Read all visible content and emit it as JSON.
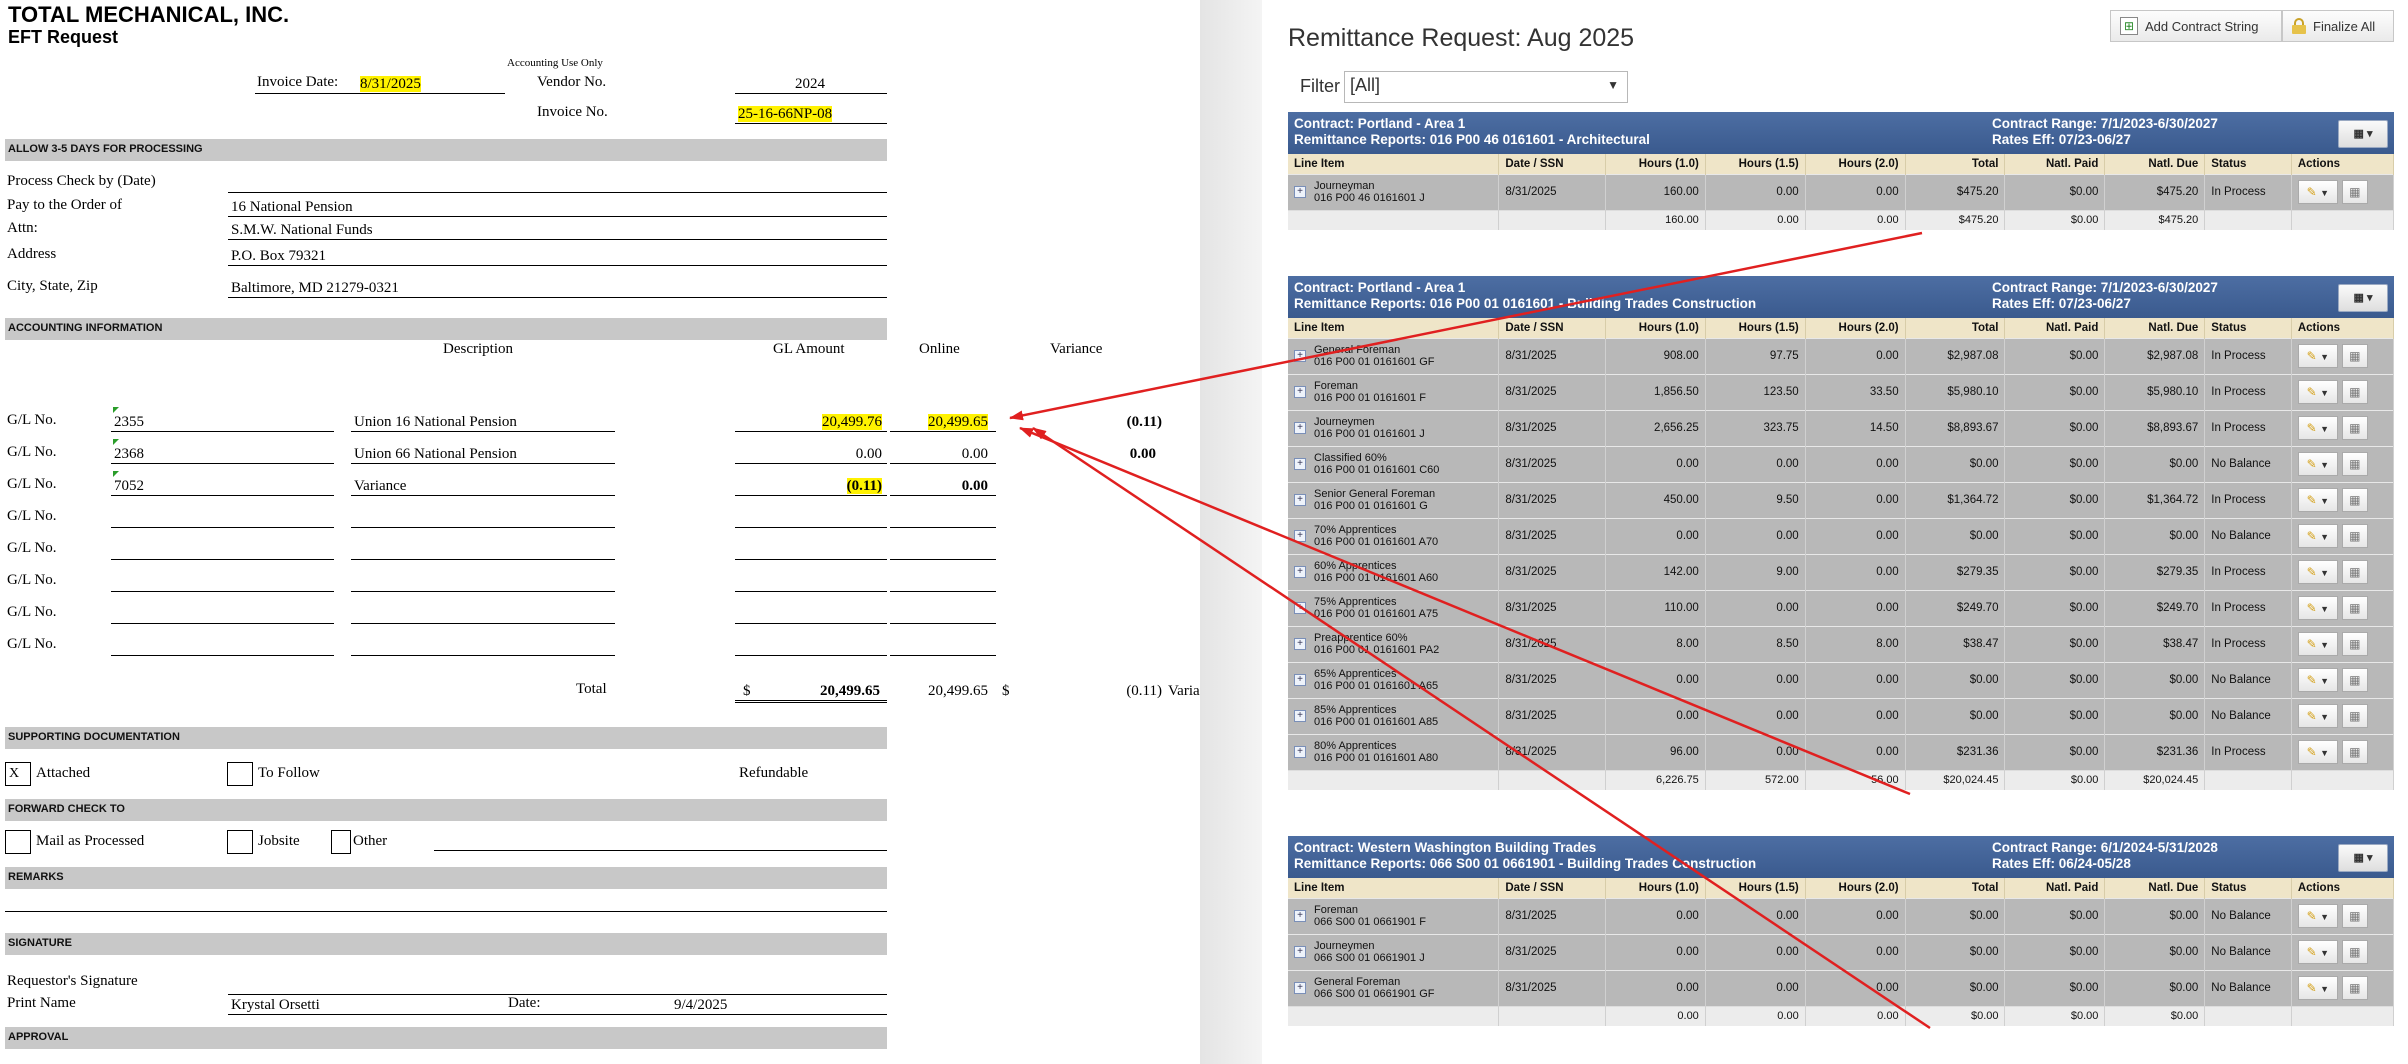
{
  "form": {
    "company": "TOTAL MECHANICAL, INC.",
    "title": "EFT Request",
    "accounting_use_only": "Accounting Use Only",
    "invoice_date_label": "Invoice Date:",
    "invoice_date": "8/31/2025",
    "vendor_no_label": "Vendor No.",
    "vendor_no": "2024",
    "invoice_no_label": "Invoice No.",
    "invoice_no": "25-16-66NP-08",
    "allow_bar": "ALLOW 3-5 DAYS FOR PROCESSING",
    "process_check_label": "Process Check by (Date)",
    "pay_to_label": "Pay to the Order of",
    "pay_to": "16 National Pension",
    "attn_label": "Attn:",
    "attn": "S.M.W. National Funds",
    "address_label": "Address",
    "address": "P.O. Box 79321",
    "city_label": "City, State, Zip",
    "city": "Baltimore, MD 21279-0321",
    "accounting_bar": "ACCOUNTING INFORMATION",
    "col_description": "Description",
    "col_gl_amount": "GL Amount",
    "col_online": "Online",
    "col_variance": "Variance",
    "gl_label": "G/L No.",
    "gl_rows": [
      {
        "no": "2355",
        "desc": "Union 16 National Pension",
        "amount": "20,499.76",
        "online": "20,499.65",
        "variance": "(0.11)"
      },
      {
        "no": "2368",
        "desc": "Union 66 National Pension",
        "amount": "0.00",
        "online": "0.00",
        "variance": "0.00"
      },
      {
        "no": "7052",
        "desc": "Variance",
        "amount": "(0.11)",
        "online": "0.00",
        "variance": ""
      },
      {
        "no": "",
        "desc": "",
        "amount": "",
        "online": "",
        "variance": ""
      },
      {
        "no": "",
        "desc": "",
        "amount": "",
        "online": "",
        "variance": ""
      },
      {
        "no": "",
        "desc": "",
        "amount": "",
        "online": "",
        "variance": ""
      },
      {
        "no": "",
        "desc": "",
        "amount": "",
        "online": "",
        "variance": ""
      },
      {
        "no": "",
        "desc": "",
        "amount": "",
        "online": "",
        "variance": ""
      }
    ],
    "total_label": "Total",
    "dollar": "$",
    "total_amount": "20,499.65",
    "total_online": "20,499.65",
    "total_variance": "(0.11)",
    "total_variance_label": "Varia",
    "supporting_bar": "SUPPORTING DOCUMENTATION",
    "attached_mark": "X",
    "attached_label": "Attached",
    "to_follow_label": "To Follow",
    "refundable_label": "Refundable",
    "forward_bar": "FORWARD CHECK TO",
    "mail_label": "Mail as Processed",
    "jobsite_label": "Jobsite",
    "other_label": "Other",
    "remarks_bar": "REMARKS",
    "signature_bar": "SIGNATURE",
    "requestor_label": "Requestor's Signature",
    "print_name_label": "Print Name",
    "print_name": "Krystal Orsetti",
    "date_label": "Date:",
    "date": "9/4/2025",
    "approval_bar": "APPROVAL"
  },
  "remit": {
    "title": "Remittance Request: Aug 2025",
    "add_contract_btn": "Add Contract String",
    "finalize_btn": "Finalize All",
    "filter_label": "Filter",
    "filter_value": "[All]",
    "columns": [
      "Line Item",
      "Date / SSN",
      "Hours (1.0)",
      "Hours (1.5)",
      "Hours (2.0)",
      "Total",
      "Natl. Paid",
      "Natl. Due",
      "Status",
      "Actions"
    ],
    "panels": [
      {
        "contract": "Contract: Portland - Area 1",
        "reports": "Remittance Reports: 016 P00 46 0161601 - Architectural",
        "range": "Contract Range: 7/1/2023-6/30/2027",
        "rates": "Rates Eff: 07/23-06/27",
        "rows": [
          {
            "name": "Journeyman",
            "code": "016 P00 46 0161601 J",
            "date": "8/31/2025",
            "h1": "160.00",
            "h15": "0.00",
            "h2": "0.00",
            "total": "$475.20",
            "paid": "$0.00",
            "due": "$475.20",
            "status": "In Process"
          }
        ],
        "sum": {
          "h1": "160.00",
          "h15": "0.00",
          "h2": "0.00",
          "total": "$475.20",
          "paid": "$0.00",
          "due": "$475.20"
        }
      },
      {
        "contract": "Contract: Portland - Area 1",
        "reports": "Remittance Reports: 016 P00 01 0161601 - Building Trades Construction",
        "range": "Contract Range: 7/1/2023-6/30/2027",
        "rates": "Rates Eff: 07/23-06/27",
        "rows": [
          {
            "name": "General Foreman",
            "code": "016 P00 01 0161601 GF",
            "date": "8/31/2025",
            "h1": "908.00",
            "h15": "97.75",
            "h2": "0.00",
            "total": "$2,987.08",
            "paid": "$0.00",
            "due": "$2,987.08",
            "status": "In Process"
          },
          {
            "name": "Foreman",
            "code": "016 P00 01 0161601 F",
            "date": "8/31/2025",
            "h1": "1,856.50",
            "h15": "123.50",
            "h2": "33.50",
            "total": "$5,980.10",
            "paid": "$0.00",
            "due": "$5,980.10",
            "status": "In Process"
          },
          {
            "name": "Journeymen",
            "code": "016 P00 01 0161601 J",
            "date": "8/31/2025",
            "h1": "2,656.25",
            "h15": "323.75",
            "h2": "14.50",
            "total": "$8,893.67",
            "paid": "$0.00",
            "due": "$8,893.67",
            "status": "In Process"
          },
          {
            "name": "Classified 60%",
            "code": "016 P00 01 0161601 C60",
            "date": "8/31/2025",
            "h1": "0.00",
            "h15": "0.00",
            "h2": "0.00",
            "total": "$0.00",
            "paid": "$0.00",
            "due": "$0.00",
            "status": "No Balance"
          },
          {
            "name": "Senior General Foreman",
            "code": "016 P00 01 0161601 G",
            "date": "8/31/2025",
            "h1": "450.00",
            "h15": "9.50",
            "h2": "0.00",
            "total": "$1,364.72",
            "paid": "$0.00",
            "due": "$1,364.72",
            "status": "In Process"
          },
          {
            "name": "70% Apprentices",
            "code": "016 P00 01 0161601 A70",
            "date": "8/31/2025",
            "h1": "0.00",
            "h15": "0.00",
            "h2": "0.00",
            "total": "$0.00",
            "paid": "$0.00",
            "due": "$0.00",
            "status": "No Balance"
          },
          {
            "name": "60% Apprentices",
            "code": "016 P00 01 0161601 A60",
            "date": "8/31/2025",
            "h1": "142.00",
            "h15": "9.00",
            "h2": "0.00",
            "total": "$279.35",
            "paid": "$0.00",
            "due": "$279.35",
            "status": "In Process"
          },
          {
            "name": "75% Apprentices",
            "code": "016 P00 01 0161601 A75",
            "date": "8/31/2025",
            "h1": "110.00",
            "h15": "0.00",
            "h2": "0.00",
            "total": "$249.70",
            "paid": "$0.00",
            "due": "$249.70",
            "status": "In Process"
          },
          {
            "name": "Preapprentice 60%",
            "code": "016 P00 01 0161601 PA2",
            "date": "8/31/2025",
            "h1": "8.00",
            "h15": "8.50",
            "h2": "8.00",
            "total": "$38.47",
            "paid": "$0.00",
            "due": "$38.47",
            "status": "In Process"
          },
          {
            "name": "65% Apprentices",
            "code": "016 P00 01 0161601 A65",
            "date": "8/31/2025",
            "h1": "0.00",
            "h15": "0.00",
            "h2": "0.00",
            "total": "$0.00",
            "paid": "$0.00",
            "due": "$0.00",
            "status": "No Balance"
          },
          {
            "name": "85% Apprentices",
            "code": "016 P00 01 0161601 A85",
            "date": "8/31/2025",
            "h1": "0.00",
            "h15": "0.00",
            "h2": "0.00",
            "total": "$0.00",
            "paid": "$0.00",
            "due": "$0.00",
            "status": "No Balance"
          },
          {
            "name": "80% Apprentices",
            "code": "016 P00 01 0161601 A80",
            "date": "8/31/2025",
            "h1": "96.00",
            "h15": "0.00",
            "h2": "0.00",
            "total": "$231.36",
            "paid": "$0.00",
            "due": "$231.36",
            "status": "In Process"
          }
        ],
        "sum": {
          "h1": "6,226.75",
          "h15": "572.00",
          "h2": "56.00",
          "total": "$20,024.45",
          "paid": "$0.00",
          "due": "$20,024.45"
        }
      },
      {
        "contract": "Contract: Western Washington Building Trades",
        "reports": "Remittance Reports: 066 S00 01 0661901 - Building Trades Construction",
        "range": "Contract Range: 6/1/2024-5/31/2028",
        "rates": "Rates Eff: 06/24-05/28",
        "rows": [
          {
            "name": "Foreman",
            "code": "066 S00 01 0661901 F",
            "date": "8/31/2025",
            "h1": "0.00",
            "h15": "0.00",
            "h2": "0.00",
            "total": "$0.00",
            "paid": "$0.00",
            "due": "$0.00",
            "status": "No Balance"
          },
          {
            "name": "Journeymen",
            "code": "066 S00 01 0661901 J",
            "date": "8/31/2025",
            "h1": "0.00",
            "h15": "0.00",
            "h2": "0.00",
            "total": "$0.00",
            "paid": "$0.00",
            "due": "$0.00",
            "status": "No Balance"
          },
          {
            "name": "General Foreman",
            "code": "066 S00 01 0661901 GF",
            "date": "8/31/2025",
            "h1": "0.00",
            "h15": "0.00",
            "h2": "0.00",
            "total": "$0.00",
            "paid": "$0.00",
            "due": "$0.00",
            "status": "No Balance"
          }
        ],
        "sum": {
          "h1": "0.00",
          "h15": "0.00",
          "h2": "0.00",
          "total": "$0.00",
          "paid": "$0.00",
          "due": "$0.00"
        }
      }
    ]
  },
  "colors": {
    "highlight": "#fff200",
    "arrow": "#e02020",
    "panel_header": "#3f5f93",
    "table_header": "#efe5c8",
    "row_fill": "#b8b8b8"
  },
  "icons": [
    "add-contract-icon",
    "lock-icon",
    "options-menu-icon",
    "pencil-icon",
    "calculator-icon",
    "expand-plus-icon",
    "chevron-down-icon"
  ]
}
